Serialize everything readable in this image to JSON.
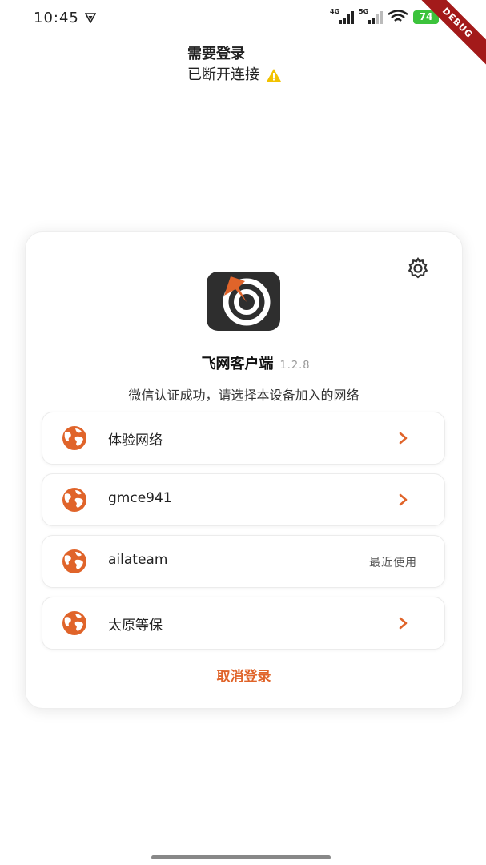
{
  "status_bar": {
    "time": "10:45",
    "signal1_label": "4G",
    "signal2_label": "5G",
    "battery": "74",
    "debug_label": "DEBUG"
  },
  "header": {
    "title": "需要登录",
    "connection_status": "已断开连接"
  },
  "card": {
    "app_name": "飞网客户端",
    "version": "1.2.8",
    "instruction": "微信认证成功，请选择本设备加入的网络",
    "networks": [
      {
        "name": "体验网络",
        "trailing": "chevron"
      },
      {
        "name": "gmce941",
        "trailing": "chevron"
      },
      {
        "name": "ailateam",
        "trailing": "recent",
        "tag": "最近使用"
      },
      {
        "name": "太原等保",
        "trailing": "chevron"
      }
    ],
    "cancel_label": "取消登录"
  },
  "colors": {
    "accent": "#e0642a",
    "battery": "#3cc33c",
    "debug_ribbon": "#a31a1a",
    "warning": "#f2c200",
    "logo_bg": "#2e2e2e"
  },
  "icons": {
    "settings": "gear-icon",
    "network": "globe-icon",
    "chevron": "chevron-right-icon",
    "warning": "warning-icon"
  }
}
